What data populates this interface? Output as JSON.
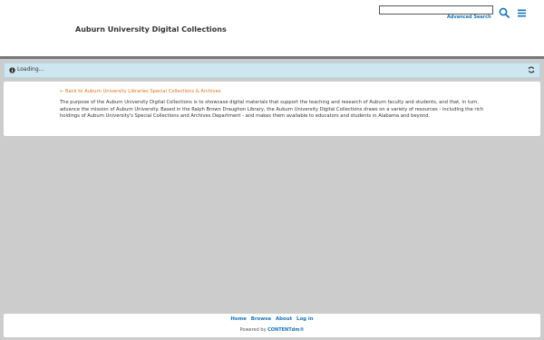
{
  "header": {
    "site_title": "Auburn University Digital Collections",
    "search": {
      "value": "",
      "placeholder": ""
    },
    "advanced_search_label": "Advanced Search",
    "search_icon": "search-icon",
    "menu_icon": "hamburger-menu-icon"
  },
  "loading": {
    "text": "Loading...",
    "info_icon": "info-icon",
    "refresh_icon": "refresh-icon"
  },
  "content": {
    "back_link": "← Back to Auburn University Libraries Special Collections & Archives",
    "description": "The purpose of the Auburn University Digital Collections is to showcase digital materials that support the teaching and research of Auburn faculty and students, and that, in turn, advance the mission of Auburn University. Based in the Ralph Brown Draughon Library, the Auburn University Digital Collections draws on a variety of resources - including the rich holdings of Auburn University's Special Collections and Archives Department - and makes them available to educators and students in Alabama and beyond."
  },
  "footer": {
    "nav": [
      "Home",
      "Browse",
      "About",
      "Log in"
    ],
    "powered_prefix": "Powered by",
    "powered_brand": "CONTENTdm®"
  },
  "colors": {
    "link_blue": "#1a73b8",
    "link_orange": "#e0731e",
    "loading_bg": "#cde6ef",
    "page_bg": "#cccccc"
  }
}
